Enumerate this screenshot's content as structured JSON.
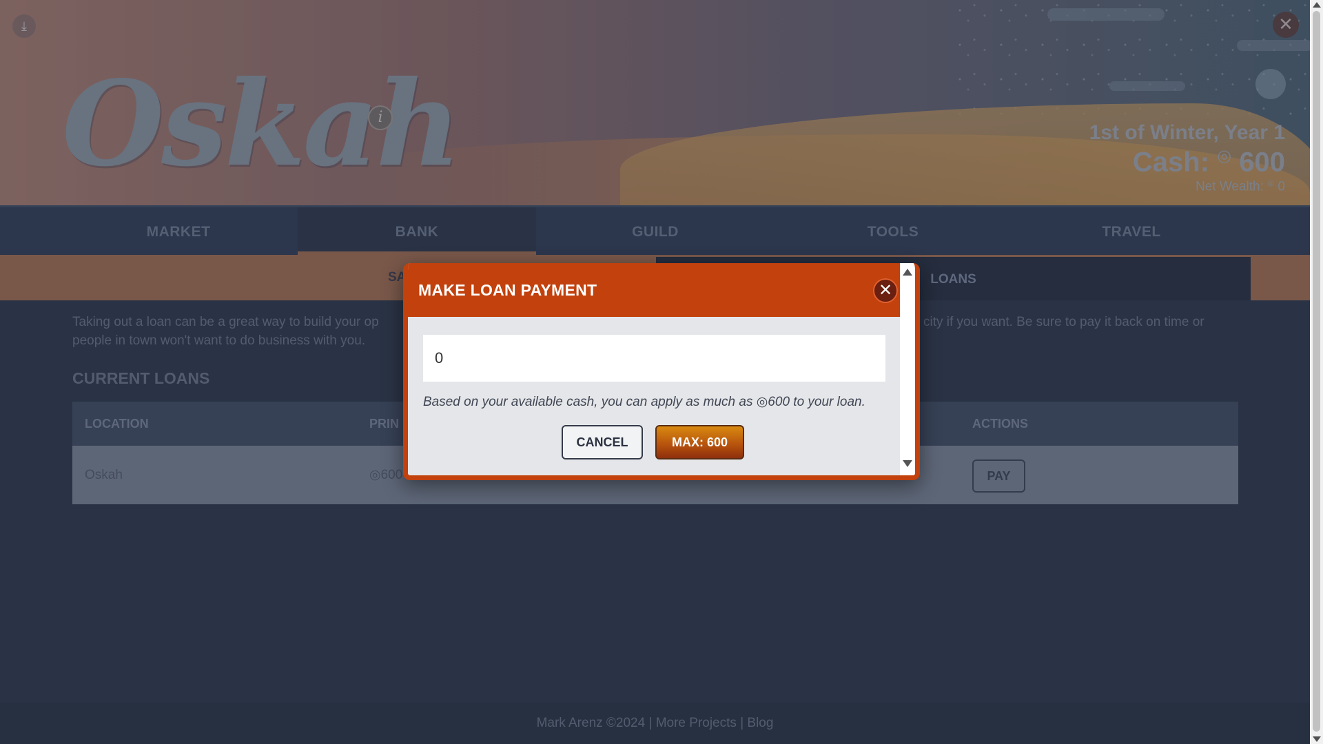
{
  "header": {
    "logo_text": "Oskah",
    "info_icon": "i",
    "download_icon": "⤓",
    "close_icon": "✕",
    "date": "1st of Winter, Year 1",
    "cash_label": "Cash:",
    "currency_symbol": "◎",
    "cash_value": "600",
    "net_wealth_label": "Net Wealth:",
    "net_wealth_value": "0"
  },
  "nav": {
    "items": [
      {
        "label": "MARKET"
      },
      {
        "label": "BANK"
      },
      {
        "label": "GUILD"
      },
      {
        "label": "TOOLS"
      },
      {
        "label": "TRAVEL"
      }
    ],
    "active": "BANK"
  },
  "subtabs": {
    "items": [
      {
        "label": "SAVINGS"
      },
      {
        "label": "LOANS"
      }
    ],
    "active": "LOANS"
  },
  "main": {
    "intro_line1_start": "Taking out a loan can be a great way to build your op",
    "intro_line1_end": "city if you want. Be sure to pay it back on time or",
    "intro_line2": "people in town won't want to do business with you.",
    "current_loans_title": "CURRENT LOANS",
    "table": {
      "headers": [
        "LOCATION",
        "PRIN",
        "ACTIONS"
      ],
      "rows": [
        {
          "location": "Oskah",
          "principal": "◎600",
          "action": "PAY"
        }
      ]
    }
  },
  "footer": {
    "author": "Mark Arenz ©2024",
    "separator": "|",
    "more_projects": "More Projects",
    "blog": "Blog"
  },
  "modal": {
    "title": "MAKE LOAN PAYMENT",
    "close_icon": "✕",
    "input_value": "0",
    "help_text": "Based on your available cash, you can apply as much as ◎600 to your loan.",
    "cancel_label": "CANCEL",
    "max_label": "MAX: 600"
  },
  "colors": {
    "accent": "#c2410c",
    "nav_bg": "#2e3a52",
    "subtab_bg": "#a56e4f",
    "page_bg": "#2b3548"
  }
}
